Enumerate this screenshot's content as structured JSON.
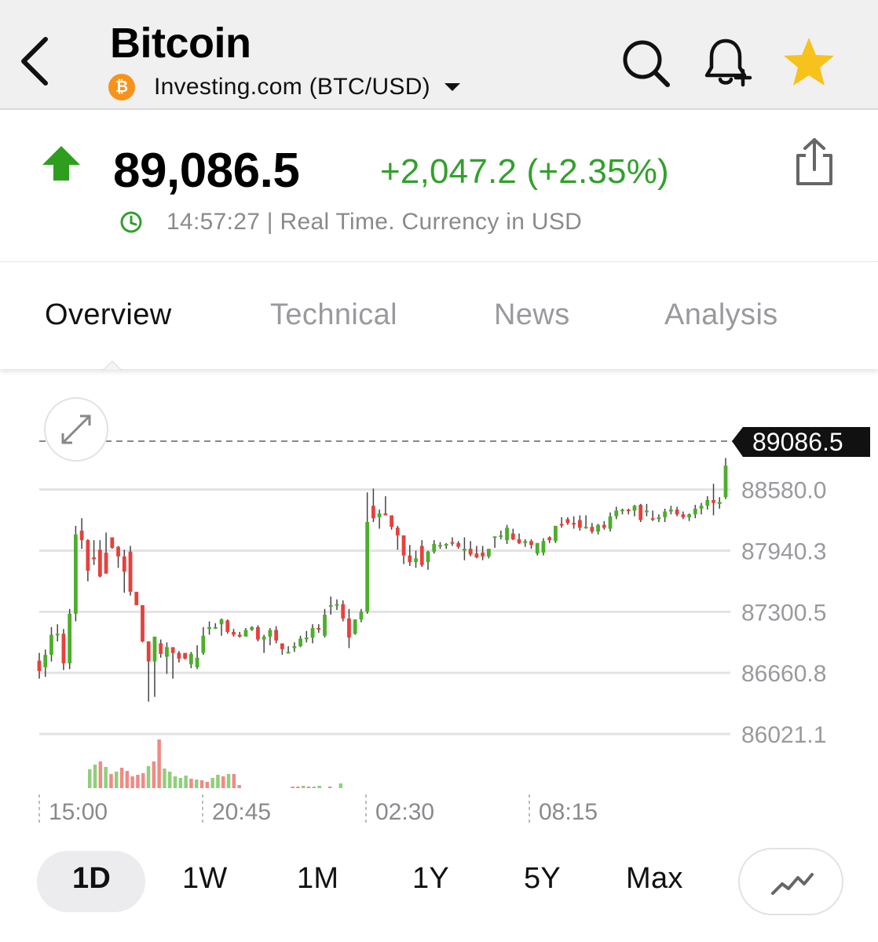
{
  "header": {
    "title": "Bitcoin",
    "source": "Investing.com (BTC/USD)",
    "coin_badge": "₿",
    "icons": [
      "back-chevron-icon",
      "search-icon",
      "bell-plus-icon",
      "star-icon"
    ],
    "favorite": true
  },
  "quote": {
    "price": "89,086.5",
    "change": "+2,047.2 (+2.35%)",
    "timestamp": "14:57:27 | Real Time. Currency in USD",
    "direction": "up"
  },
  "tabs": [
    {
      "label": "Overview",
      "active": true
    },
    {
      "label": "Technical",
      "active": false
    },
    {
      "label": "News",
      "active": false
    },
    {
      "label": "Analysis",
      "active": false
    }
  ],
  "chart": {
    "current_price_label": "89086.5"
  },
  "periods": [
    {
      "label": "1D",
      "selected": true
    },
    {
      "label": "1W",
      "selected": false
    },
    {
      "label": "1M",
      "selected": false
    },
    {
      "label": "1Y",
      "selected": false
    },
    {
      "label": "5Y",
      "selected": false
    },
    {
      "label": "Max",
      "selected": false
    }
  ],
  "colors": {
    "up": "#4caf2a",
    "down": "#e8403b",
    "change_text": "#32a02c",
    "star": "#f7c21b",
    "bitcoin": "#f7931a"
  },
  "chart_data": {
    "type": "candlestick",
    "y_ticks": [
      "88580.0",
      "87940.3",
      "87300.5",
      "86660.8",
      "86021.1"
    ],
    "y_tick_values": [
      88580.0,
      87940.3,
      87300.5,
      86660.8,
      86021.1
    ],
    "ylim": [
      86021.1,
      89086.5
    ],
    "x_ticks": [
      "15:00",
      "20:45",
      "02:30",
      "08:15"
    ],
    "last_price": 89086.5,
    "grid": true,
    "candles": [
      [
        86789,
        86870,
        86600,
        86680
      ],
      [
        86720,
        86905,
        86620,
        86850
      ],
      [
        86850,
        87140,
        86780,
        87060
      ],
      [
        87060,
        87170,
        86990,
        87070
      ],
      [
        87070,
        87120,
        86690,
        86760
      ],
      [
        86760,
        87330,
        86700,
        87280
      ],
      [
        87280,
        88200,
        87200,
        88110
      ],
      [
        88150,
        88280,
        87960,
        88050
      ],
      [
        88050,
        88060,
        87620,
        87730
      ],
      [
        87870,
        88050,
        87790,
        87850
      ],
      [
        87950,
        88050,
        87660,
        87670
      ],
      [
        87920,
        88130,
        87700,
        87700
      ],
      [
        88080,
        88020,
        87960,
        87970
      ],
      [
        87980,
        87990,
        87760,
        87880
      ],
      [
        87880,
        87950,
        87500,
        87720
      ],
      [
        87930,
        87990,
        87470,
        87510
      ],
      [
        87510,
        87370,
        87430,
        87370
      ],
      [
        87370,
        87370,
        86980,
        86990
      ],
      [
        86990,
        86990,
        86360,
        86780
      ],
      [
        86780,
        86980,
        86410,
        87040
      ],
      [
        86970,
        87010,
        86820,
        86860
      ],
      [
        86830,
        86980,
        86650,
        86930
      ],
      [
        86930,
        86920,
        86600,
        86870
      ],
      [
        86870,
        86890,
        86770,
        86810
      ],
      [
        86870,
        86860,
        86800,
        86810
      ],
      [
        86750,
        86880,
        86710,
        86860
      ],
      [
        86720,
        86950,
        86700,
        86820
      ],
      [
        86870,
        87140,
        86850,
        87050
      ],
      [
        87120,
        87200,
        87060,
        87140
      ],
      [
        87130,
        87180,
        87120,
        87140
      ],
      [
        87170,
        87230,
        87050,
        87220
      ],
      [
        87210,
        87220,
        87070,
        87090
      ],
      [
        87090,
        87120,
        87040,
        87060
      ],
      [
        87060,
        87090,
        87030,
        87040
      ],
      [
        87040,
        87130,
        87060,
        87110
      ],
      [
        87110,
        87150,
        87100,
        87140
      ],
      [
        87140,
        87160,
        86990,
        87010
      ],
      [
        87010,
        87060,
        86870,
        87040
      ],
      [
        87040,
        87130,
        86950,
        87110
      ],
      [
        87110,
        87150,
        86970,
        87000
      ],
      [
        86970,
        86960,
        86850,
        86910
      ],
      [
        86880,
        86940,
        86870,
        86880
      ],
      [
        86920,
        86980,
        86880,
        86940
      ],
      [
        86940,
        87050,
        86930,
        87020
      ],
      [
        87020,
        87100,
        86980,
        87030
      ],
      [
        87030,
        87170,
        86970,
        87130
      ],
      [
        87130,
        87170,
        87080,
        87120
      ],
      [
        87050,
        87330,
        87030,
        87270
      ],
      [
        87360,
        87460,
        87270,
        87370
      ],
      [
        87380,
        87430,
        87320,
        87380
      ],
      [
        87380,
        87420,
        87200,
        87230
      ],
      [
        87230,
        87330,
        86920,
        87030
      ],
      [
        87070,
        87220,
        87060,
        87220
      ],
      [
        87220,
        87330,
        87190,
        87300
      ],
      [
        87300,
        88550,
        87280,
        88240
      ],
      [
        88410,
        88590,
        88240,
        88280
      ],
      [
        88290,
        88370,
        88170,
        88330
      ],
      [
        88330,
        88510,
        88320,
        88310
      ],
      [
        88310,
        88310,
        88160,
        88190
      ],
      [
        88180,
        88200,
        87950,
        88100
      ],
      [
        88100,
        88100,
        87800,
        87890
      ],
      [
        87890,
        88000,
        87780,
        87820
      ],
      [
        87820,
        87940,
        87760,
        87860
      ],
      [
        87990,
        88050,
        87770,
        87790
      ],
      [
        87820,
        87940,
        87740,
        87930
      ],
      [
        87930,
        88050,
        87910,
        88010
      ],
      [
        88000,
        88030,
        87960,
        88000
      ],
      [
        88000,
        88020,
        87960,
        88010
      ],
      [
        88030,
        88080,
        87990,
        88020
      ],
      [
        88020,
        88040,
        87960,
        87980
      ],
      [
        87940,
        88080,
        87840,
        87960
      ],
      [
        87960,
        88040,
        87880,
        87900
      ],
      [
        87910,
        87990,
        87860,
        87870
      ],
      [
        87920,
        87990,
        87840,
        87880
      ],
      [
        87880,
        87960,
        87860,
        87960
      ],
      [
        88090,
        88090,
        87970,
        88090
      ],
      [
        88090,
        88150,
        88060,
        88100
      ],
      [
        88050,
        88210,
        88010,
        88180
      ],
      [
        88120,
        88170,
        88050,
        88060
      ],
      [
        88060,
        88120,
        88010,
        88020
      ],
      [
        88020,
        88060,
        87980,
        88040
      ],
      [
        88040,
        88060,
        87960,
        88000
      ],
      [
        87910,
        88020,
        87890,
        88020
      ],
      [
        87920,
        88070,
        87890,
        88040
      ],
      [
        88080,
        88090,
        88020,
        88050
      ],
      [
        88040,
        88200,
        88020,
        88200
      ],
      [
        88220,
        88290,
        88180,
        88210
      ],
      [
        88270,
        88290,
        88210,
        88230
      ],
      [
        88230,
        88300,
        88170,
        88220
      ],
      [
        88260,
        88310,
        88150,
        88180
      ],
      [
        88180,
        88310,
        88170,
        88190
      ],
      [
        88190,
        88230,
        88120,
        88140
      ],
      [
        88140,
        88220,
        88110,
        88210
      ],
      [
        88210,
        88250,
        88160,
        88180
      ],
      [
        88170,
        88340,
        88140,
        88300
      ],
      [
        88300,
        88400,
        88270,
        88360
      ],
      [
        88360,
        88380,
        88320,
        88370
      ],
      [
        88370,
        88380,
        88320,
        88360
      ],
      [
        88360,
        88420,
        88300,
        88410
      ],
      [
        88420,
        88430,
        88240,
        88260
      ],
      [
        88350,
        88430,
        88300,
        88360
      ],
      [
        88280,
        88360,
        88250,
        88270
      ],
      [
        88270,
        88320,
        88240,
        88290
      ],
      [
        88290,
        88380,
        88240,
        88350
      ],
      [
        88350,
        88410,
        88320,
        88370
      ],
      [
        88370,
        88400,
        88300,
        88320
      ],
      [
        88320,
        88350,
        88270,
        88290
      ],
      [
        88290,
        88330,
        88250,
        88320
      ],
      [
        88320,
        88420,
        88280,
        88380
      ],
      [
        88380,
        88440,
        88320,
        88410
      ],
      [
        88410,
        88510,
        88370,
        88470
      ],
      [
        88470,
        88640,
        88310,
        88440
      ],
      [
        88430,
        88500,
        88380,
        88450
      ],
      [
        88500,
        88910,
        88480,
        88830
      ]
    ],
    "volume": [
      [
        0,
        24,
        "up"
      ],
      [
        0,
        30,
        "up"
      ],
      [
        0,
        34,
        "down"
      ],
      [
        0,
        27,
        "up"
      ],
      [
        0,
        18,
        "down"
      ],
      [
        0,
        21,
        "up"
      ],
      [
        0,
        26,
        "down"
      ],
      [
        0,
        22,
        "down"
      ],
      [
        0,
        15,
        "down"
      ],
      [
        0,
        17,
        "down"
      ],
      [
        0,
        19,
        "down"
      ],
      [
        0,
        28,
        "up"
      ],
      [
        0,
        34,
        "down"
      ],
      [
        0,
        62,
        "down"
      ],
      [
        0,
        25,
        "up"
      ],
      [
        0,
        21,
        "up"
      ],
      [
        0,
        15,
        "up"
      ],
      [
        0,
        13,
        "up"
      ],
      [
        0,
        16,
        "up"
      ],
      [
        0,
        12,
        "down"
      ],
      [
        0,
        11,
        "up"
      ],
      [
        0,
        10,
        "down"
      ],
      [
        0,
        8,
        "down"
      ],
      [
        0,
        13,
        "up"
      ],
      [
        0,
        17,
        "up"
      ],
      [
        0,
        15,
        "down"
      ],
      [
        0,
        18,
        "up"
      ],
      [
        0,
        18,
        "down"
      ],
      [
        0,
        4,
        "down"
      ],
      [
        0,
        0,
        ""
      ],
      [
        0,
        0,
        ""
      ],
      [
        0,
        0,
        ""
      ],
      [
        0,
        0,
        ""
      ],
      [
        0,
        0,
        ""
      ],
      [
        0,
        0,
        ""
      ],
      [
        0,
        0,
        ""
      ],
      [
        0,
        0,
        ""
      ],
      [
        0,
        0,
        ""
      ],
      [
        0,
        2,
        "down"
      ],
      [
        0,
        2,
        "down"
      ],
      [
        0,
        3,
        "up"
      ],
      [
        0,
        2,
        "down"
      ],
      [
        0,
        2,
        "up"
      ],
      [
        0,
        3,
        "up"
      ],
      [
        0,
        0,
        ""
      ],
      [
        0,
        2,
        "down"
      ],
      [
        0,
        0,
        ""
      ],
      [
        0,
        6,
        "up"
      ]
    ]
  }
}
